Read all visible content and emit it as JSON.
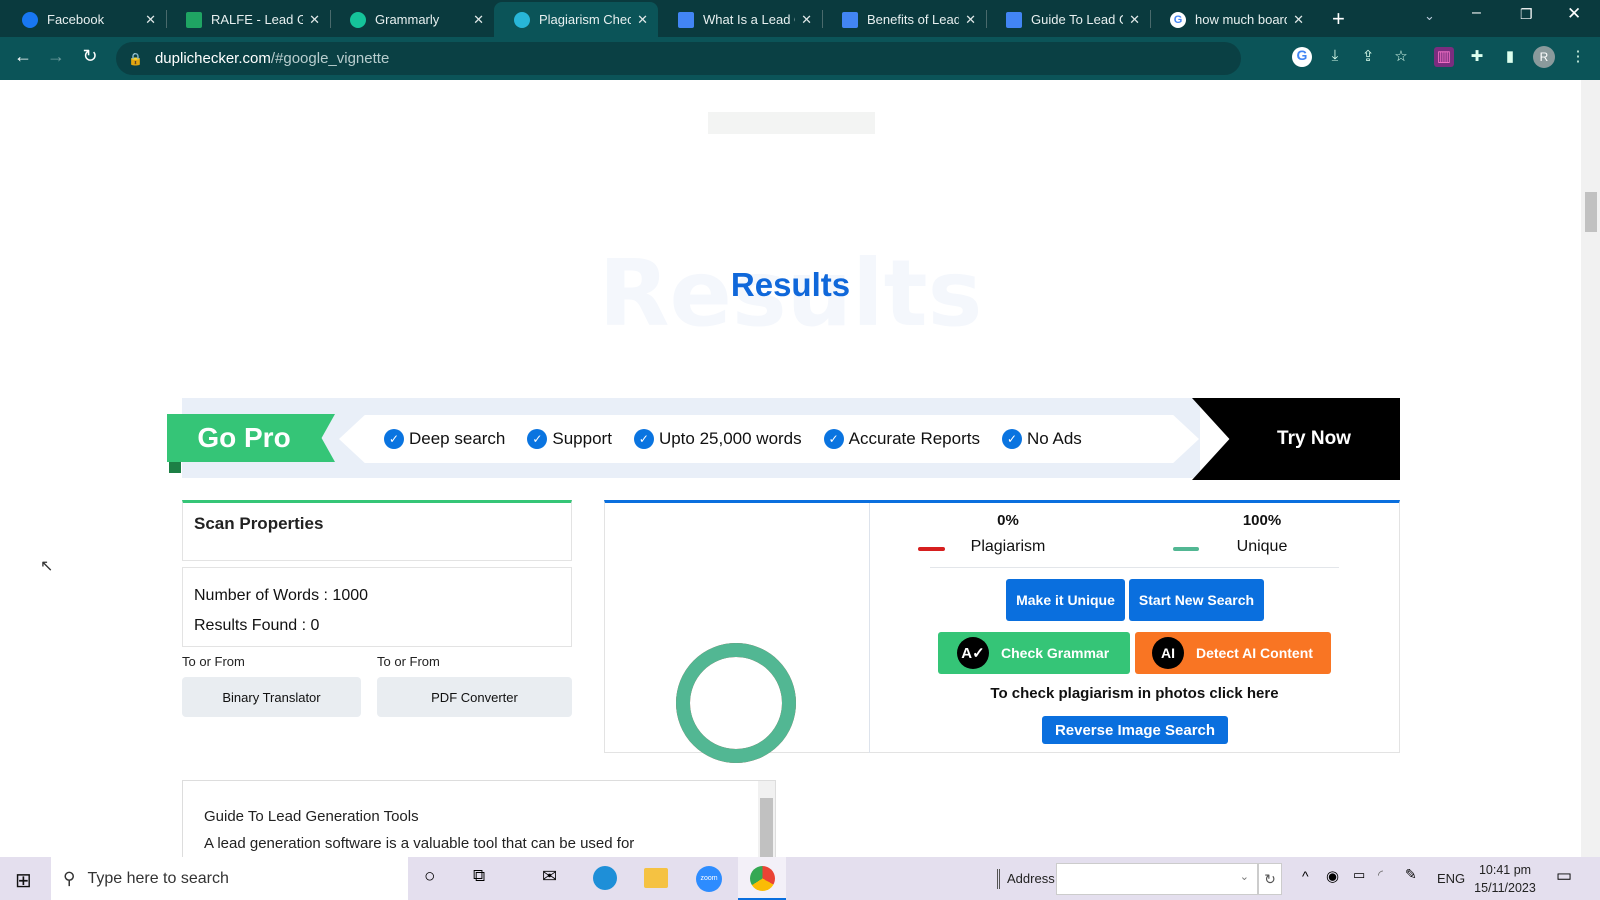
{
  "browser": {
    "tabs": [
      {
        "label": "Facebook",
        "icon": "facebook-icon",
        "color": "#1877f2"
      },
      {
        "label": "RALFE - Lead Gen",
        "icon": "sheets-icon",
        "color": "#1fa463"
      },
      {
        "label": "Grammarly",
        "icon": "grammarly-icon",
        "color": "#15c39a"
      },
      {
        "label": "Plagiarism Checker",
        "icon": "duplichecker-icon",
        "color": "#28b6d8"
      },
      {
        "label": "What Is a Lead Gen",
        "icon": "docs-icon",
        "color": "#4285f4"
      },
      {
        "label": "Benefits of Lead Gen",
        "icon": "docs-icon",
        "color": "#4285f4"
      },
      {
        "label": "Guide To Lead Gen",
        "icon": "docs-icon",
        "color": "#4285f4"
      },
      {
        "label": "how much board",
        "icon": "google-icon",
        "color": "#ffffff"
      }
    ],
    "active_tab": 3,
    "url_host": "duplichecker.com",
    "url_rest": "/#google_vignette",
    "profile_initial": "R"
  },
  "page": {
    "watermark": "Results",
    "title": "Results",
    "promo": {
      "badge": "Go Pro",
      "features": [
        "Deep search",
        "Support",
        "Upto 25,000 words",
        "Accurate Reports",
        "No Ads"
      ],
      "cta": "Try Now"
    },
    "scan": {
      "heading": "Scan Properties",
      "words_label": "Number of Words : 1000",
      "results_label": "Results Found : 0",
      "links": [
        {
          "caption": "To or From",
          "button": "Binary Translator"
        },
        {
          "caption": "To or From",
          "button": "PDF Converter"
        }
      ]
    },
    "result": {
      "plagiarism_pct": "0%",
      "plagiarism_label": "Plagiarism",
      "unique_pct": "100%",
      "unique_label": "Unique",
      "unique_fraction": 1.0,
      "plagiarism_color": "#d61f1f",
      "unique_color": "#52b793",
      "make_unique": "Make it Unique",
      "new_search": "Start New Search",
      "check_grammar": "Check Grammar",
      "detect_ai": "Detect AI Content",
      "photo_text": "To check plagiarism in photos click here",
      "reverse_image": "Reverse Image Search"
    },
    "textbox": {
      "line1": "Guide To Lead Generation Tools",
      "line2": "A lead generation software is a valuable tool that can be used for"
    }
  },
  "taskbar": {
    "search_placeholder": "Type here to search",
    "address_label": "Address",
    "language": "ENG",
    "time": "10:41 pm",
    "date": "15/11/2023"
  }
}
